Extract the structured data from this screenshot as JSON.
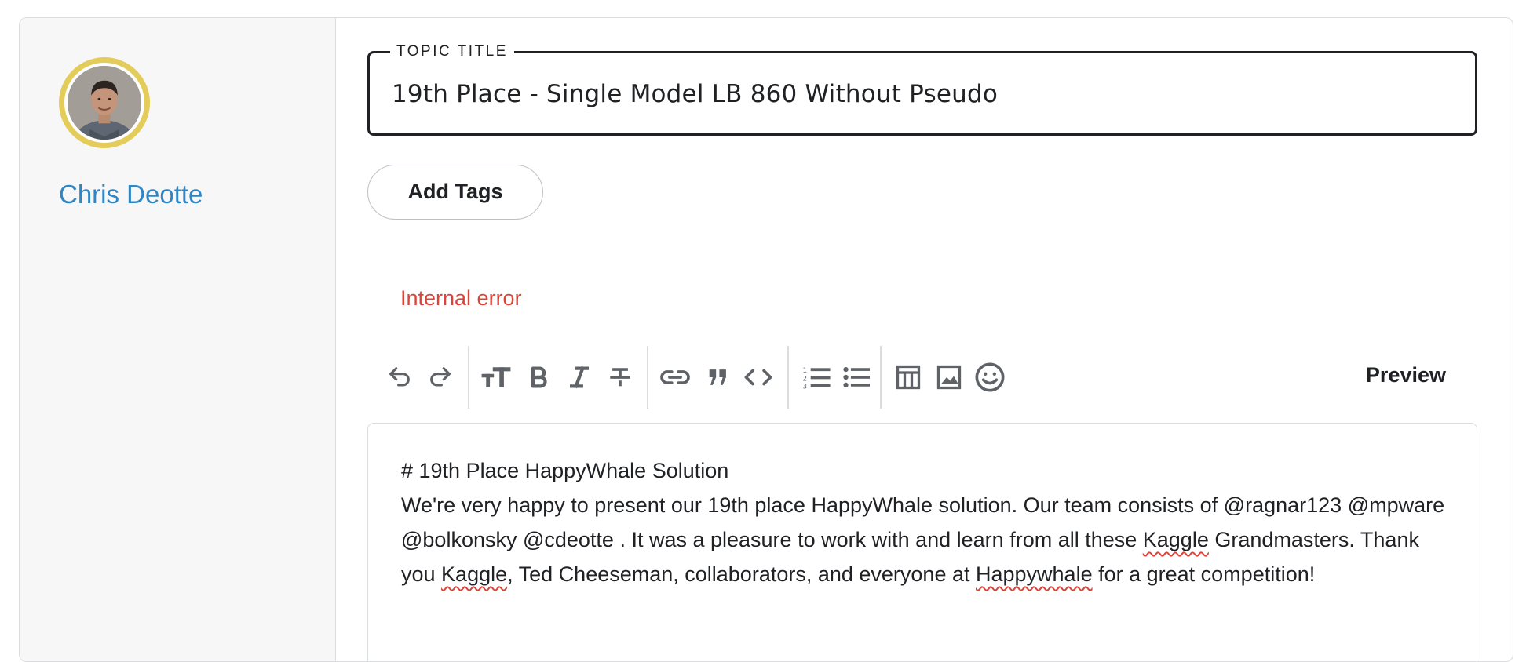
{
  "user": {
    "name": "Chris Deotte",
    "avatar_icon": "user-avatar-photo"
  },
  "title_field": {
    "legend": "TOPIC TITLE",
    "value": "19th Place - Single Model LB 860 Without Pseudo"
  },
  "tags": {
    "button_label": "Add Tags"
  },
  "status": {
    "error": "Internal error",
    "error_color": "#d9453a"
  },
  "toolbar": {
    "icons": [
      "undo-icon",
      "redo-icon",
      "text-size-icon",
      "bold-icon",
      "italic-icon",
      "strikethrough-icon",
      "link-icon",
      "quote-icon",
      "code-icon",
      "ordered-list-icon",
      "bulleted-list-icon",
      "table-icon",
      "image-icon",
      "emoji-icon"
    ],
    "preview_label": "Preview"
  },
  "editor": {
    "heading_line": "# 19th Place HappyWhale Solution",
    "body_part1": "We're very happy to present our 19th place HappyWhale solution. Our team consists of @ragnar123 @mpware @bolkonsky @cdeotte . It was a pleasure to work with and learn from all these ",
    "spell_word1": "Kaggle",
    "body_part2": " Grandmasters. Thank you ",
    "spell_word2": "Kaggle",
    "body_part3": ", Ted Cheeseman, collaborators, and everyone at ",
    "spell_word3": "Happywhale",
    "body_part4": " for a great competition!"
  },
  "colors": {
    "accent_link": "#2f86c2",
    "avatar_ring": "#e3cc5a",
    "sidebar_bg": "#f7f7f7"
  }
}
